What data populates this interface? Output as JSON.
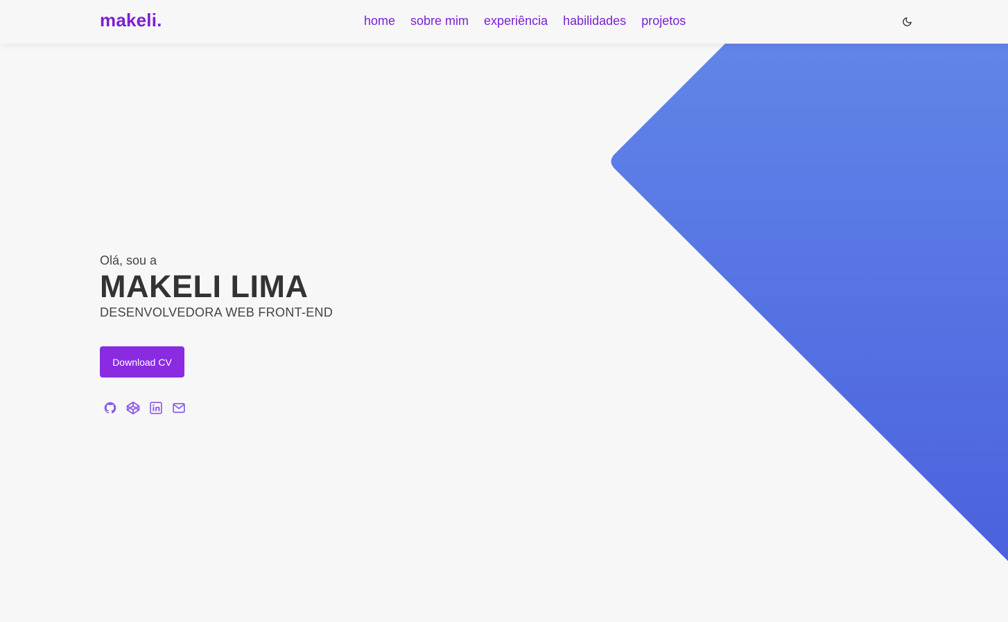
{
  "header": {
    "logo": "makeli.",
    "nav": [
      {
        "label": "home"
      },
      {
        "label": "sobre mim"
      },
      {
        "label": "experiência"
      },
      {
        "label": "habilidades"
      },
      {
        "label": "projetos"
      }
    ],
    "theme_toggle_icon": "moon-icon"
  },
  "hero": {
    "greeting": "Olá, sou a",
    "name": "MAKELI LIMA",
    "role": "DESENVOLVEDORA WEB FRONT-END",
    "cta_label": "Download CV"
  },
  "socials": [
    {
      "icon": "github-icon"
    },
    {
      "icon": "codepen-icon"
    },
    {
      "icon": "linkedin-icon"
    },
    {
      "icon": "mail-icon"
    }
  ],
  "colors": {
    "accent": "#8a2be2",
    "nav": "#7a1fd6",
    "shape_top": "#6085e8",
    "shape_bottom": "#4c63de",
    "background": "#f7f7f7"
  }
}
